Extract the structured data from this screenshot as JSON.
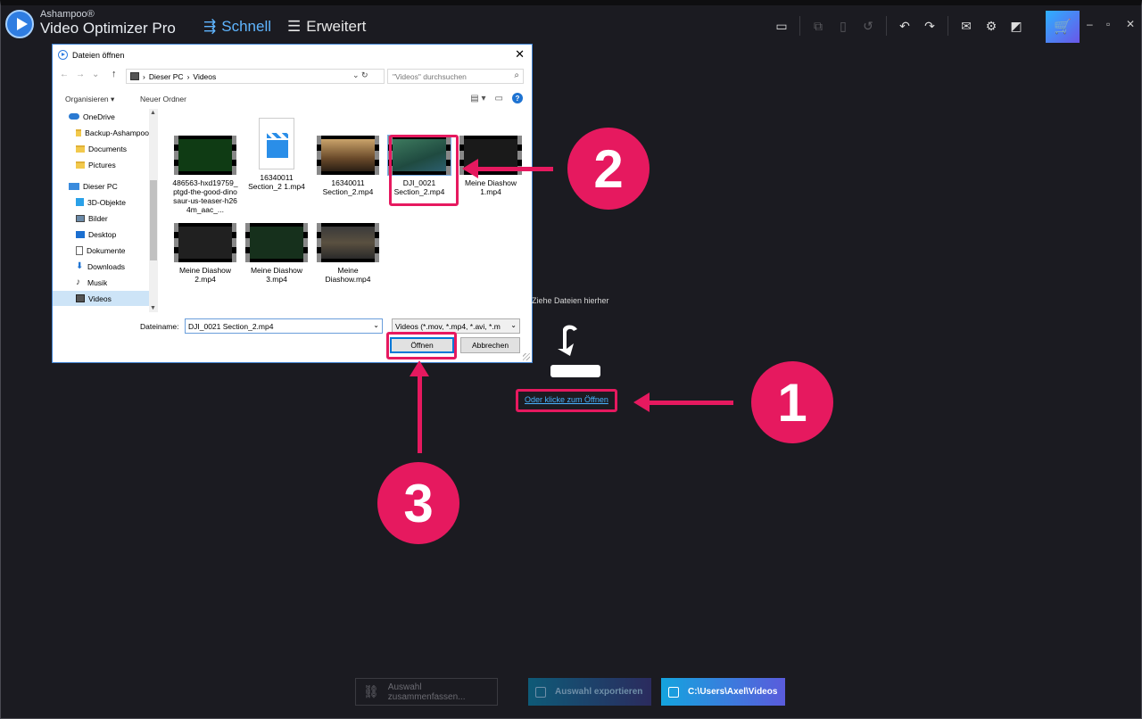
{
  "app": {
    "brand_small": "Ashampoo®",
    "brand_name": "Video Optimizer Pro",
    "nav_schnell": "Schnell",
    "nav_erweitert": "Erweitert",
    "accent_color": "#2f9bf0",
    "highlight_color": "#e6195f"
  },
  "dialog": {
    "title": "Dateien öffnen",
    "path": [
      "Dieser PC",
      "Videos"
    ],
    "search_placeholder": "\"Videos\" durchsuchen",
    "organize": "Organisieren",
    "new_folder": "Neuer Ordner",
    "tree": [
      {
        "label": "OneDrive",
        "icon": "cloud-icon"
      },
      {
        "label": "Backup-Ashampoo",
        "icon": "folder-icon"
      },
      {
        "label": "Documents",
        "icon": "folder-icon"
      },
      {
        "label": "Pictures",
        "icon": "folder-icon"
      },
      {
        "label": "Dieser PC",
        "icon": "pc-icon"
      },
      {
        "label": "3D-Objekte",
        "icon": "cube-icon"
      },
      {
        "label": "Bilder",
        "icon": "image-icon"
      },
      {
        "label": "Desktop",
        "icon": "desktop-icon"
      },
      {
        "label": "Dokumente",
        "icon": "document-icon"
      },
      {
        "label": "Downloads",
        "icon": "download-icon"
      },
      {
        "label": "Musik",
        "icon": "music-icon"
      },
      {
        "label": "Videos",
        "icon": "video-folder-icon"
      }
    ],
    "files": [
      {
        "name": "486563-hxd19759_ptgd-the-good-dinosaur-us-teaser-h264m_aac_...",
        "kind": "video"
      },
      {
        "name": "16340011 Section_2 1.mp4",
        "kind": "clapper"
      },
      {
        "name": "16340011 Section_2.mp4",
        "kind": "video"
      },
      {
        "name": "DJI_0021 Section_2.mp4",
        "kind": "video"
      },
      {
        "name": "Meine Diashow 1.mp4",
        "kind": "video"
      },
      {
        "name": "Meine Diashow 2.mp4",
        "kind": "video"
      },
      {
        "name": "Meine Diashow 3.mp4",
        "kind": "video"
      },
      {
        "name": "Meine Diashow.mp4",
        "kind": "video"
      }
    ],
    "filename_label": "Dateiname:",
    "filename_value": "DJI_0021 Section_2.mp4",
    "filetype_value": "Videos (*.mov, *.mp4, *.avi, *.m",
    "open_button": "Öffnen",
    "cancel_button": "Abbrechen"
  },
  "dropzone": {
    "text": "Ziehe Dateien hierher",
    "link": "Oder klicke zum Öffnen"
  },
  "callouts": [
    "1",
    "2",
    "3"
  ],
  "bottom": {
    "merge": "Auswahl zusammenfassen...",
    "export": "Auswahl exportieren",
    "path": "C:\\Users\\Axel\\Videos"
  }
}
